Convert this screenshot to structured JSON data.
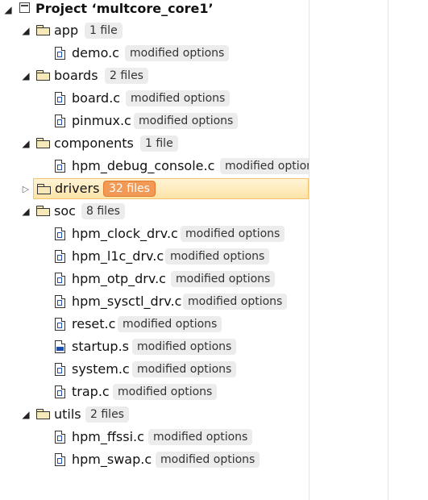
{
  "tree": {
    "root": {
      "label": "Project ‘multcore_core1’"
    },
    "groups": [
      {
        "name": "app",
        "count": "1 file",
        "files": [
          {
            "name": "demo.c",
            "badge": "modified options"
          }
        ]
      },
      {
        "name": "boards",
        "count": "2 files",
        "files": [
          {
            "name": "board.c",
            "badge": "modified options"
          },
          {
            "name": "pinmux.c",
            "badge": "modified options"
          }
        ]
      },
      {
        "name": "components",
        "count": "1 file",
        "files": [
          {
            "name": "hpm_debug_console.c",
            "badge": "modified options"
          }
        ]
      },
      {
        "name": "drivers",
        "count": "32 files",
        "files": []
      },
      {
        "name": "soc",
        "count": "8 files",
        "files": [
          {
            "name": "hpm_clock_drv.c",
            "badge": "modified options"
          },
          {
            "name": "hpm_l1c_drv.c",
            "badge": "modified options"
          },
          {
            "name": "hpm_otp_drv.c",
            "badge": "modified options"
          },
          {
            "name": "hpm_sysctl_drv.c",
            "badge": "modified options"
          },
          {
            "name": "reset.c",
            "badge": "modified options"
          },
          {
            "name": "startup.s",
            "badge": "modified options"
          },
          {
            "name": "system.c",
            "badge": "modified options"
          },
          {
            "name": "trap.c",
            "badge": "modified options"
          }
        ]
      },
      {
        "name": "utils",
        "count": "2 files",
        "files": [
          {
            "name": "hpm_ffssi.c",
            "badge": "modified options"
          },
          {
            "name": "hpm_swap.c",
            "badge": "modified options"
          }
        ]
      }
    ]
  }
}
